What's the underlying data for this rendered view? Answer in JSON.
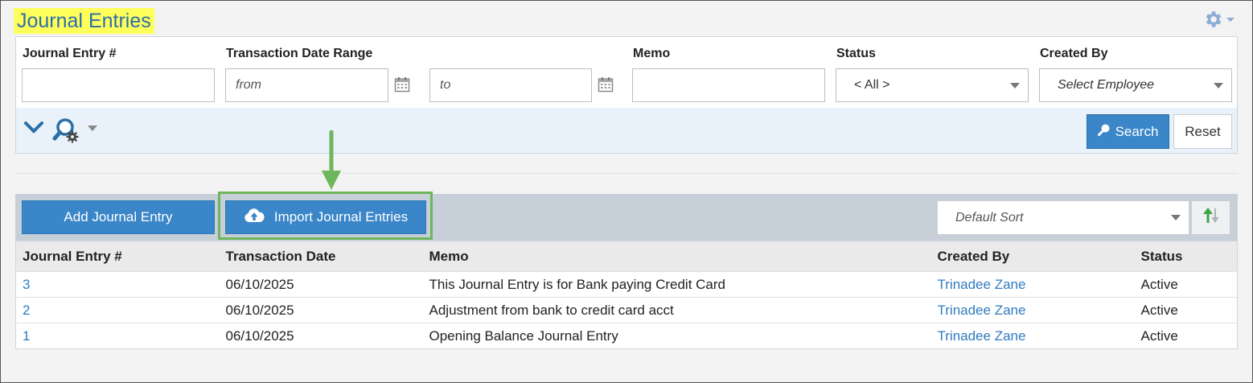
{
  "page_title": "Journal Entries",
  "icons": {
    "settings": "gear-icon",
    "calendar": "calendar-icon",
    "expand": "chevron-down-icon",
    "search_settings": "search-settings-icon",
    "search": "magnifier-icon",
    "import": "cloud-upload-icon",
    "sort_direction": "sort-direction-icon"
  },
  "colors": {
    "title_highlight": "#ffff5c",
    "title_text": "#2a6fa7",
    "primary_button": "#3a86c8",
    "link": "#2f7bbf",
    "annotation_green": "#6db65b"
  },
  "filters": {
    "journal_entry_no": {
      "label": "Journal Entry #",
      "value": "",
      "placeholder": ""
    },
    "transaction_date_range": {
      "label": "Transaction Date Range",
      "from_placeholder": "from",
      "to_placeholder": "to"
    },
    "memo": {
      "label": "Memo",
      "value": "",
      "placeholder": ""
    },
    "status": {
      "label": "Status",
      "selected": "< All >"
    },
    "created_by": {
      "label": "Created By",
      "selected": "Select Employee"
    },
    "search_label": "Search",
    "reset_label": "Reset"
  },
  "actions": {
    "add_label": "Add Journal Entry",
    "import_label": "Import Journal Entries",
    "sort_selected": "Default Sort"
  },
  "table": {
    "columns": [
      "Journal Entry #",
      "Transaction Date",
      "Memo",
      "Created By",
      "Status"
    ],
    "rows": [
      {
        "id": "3",
        "date": "06/10/2025",
        "memo": "This Journal Entry is for Bank paying Credit Card",
        "created_by": "Trinadee Zane",
        "status": "Active"
      },
      {
        "id": "2",
        "date": "06/10/2025",
        "memo": "Adjustment from bank to credit card acct",
        "created_by": "Trinadee Zane",
        "status": "Active"
      },
      {
        "id": "1",
        "date": "06/10/2025",
        "memo": "Opening Balance Journal Entry",
        "created_by": "Trinadee Zane",
        "status": "Active"
      }
    ]
  }
}
